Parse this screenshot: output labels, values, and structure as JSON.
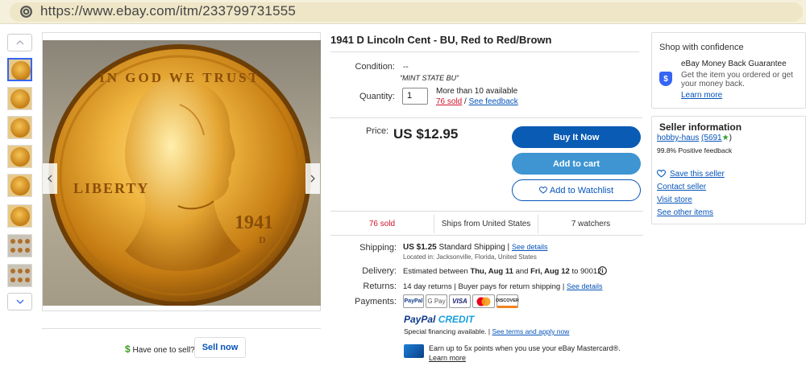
{
  "browser": {
    "url": "https://www.ebay.com/itm/233799731555"
  },
  "listing": {
    "title": "1941 D Lincoln Cent - BU, Red to Red/Brown",
    "condition_label": "Condition:",
    "condition_value": "--",
    "condition_note": "“MINT STATE BU”",
    "quantity_label": "Quantity:",
    "quantity_value": "1",
    "availability": "More than 10 available",
    "sold_link": "76 sold",
    "separator": "/",
    "feedback_link": "See feedback",
    "price_label": "Price:",
    "price": "US $12.95",
    "buy_now": "Buy It Now",
    "add_to_cart": "Add to cart",
    "add_to_watchlist": "Add to Watchlist",
    "stats": {
      "sold": "76 sold",
      "ships_from": "Ships from United States",
      "watchers": "7 watchers"
    },
    "shipping_label": "Shipping:",
    "shipping_cost": "US $1.25",
    "shipping_method": "Standard Shipping |",
    "shipping_details": "See details",
    "shipping_location": "Located in: Jacksonville, Florida, United States",
    "delivery_label": "Delivery:",
    "delivery_prefix": "Estimated between",
    "delivery_dates": "Thu, Aug 11",
    "delivery_and": "and",
    "delivery_dates2": "Fri, Aug 12",
    "delivery_suffix": "to 90012",
    "returns_label": "Returns:",
    "returns_text": "14 day returns | Buyer pays for return shipping |",
    "returns_details": "See details",
    "payments_label": "Payments:",
    "payment_methods": [
      "PayPal",
      "G Pay",
      "VISA",
      "",
      "DISCOVER"
    ],
    "paypal_credit_a": "PayPal",
    "paypal_credit_b": "CREDIT",
    "special_financing": "Special financing available. |",
    "see_terms": "See terms and apply now",
    "mastercard_text": "Earn up to 5x points when you use your eBay Mastercard®.",
    "learn_more": "Learn more"
  },
  "sell": {
    "question": "Have one to sell?",
    "button": "Sell now"
  },
  "confidence": {
    "heading": "Shop with confidence",
    "guarantee_title": "eBay Money Back Guarantee",
    "guarantee_text_1": "Get the item you ordered or get",
    "guarantee_text_2": "your money back.",
    "learn_more": "Learn more"
  },
  "seller": {
    "heading": "Seller information",
    "name": "hobby-haus",
    "score": "(5691",
    "score_end": ")",
    "positive": "99.8% Positive feedback",
    "save": "Save this seller",
    "contact": "Contact seller",
    "store": "Visit store",
    "other_items": "See other items"
  },
  "coin_text": {
    "motto": "IN GOD WE TRUST",
    "liberty": "LIBERTY",
    "year": "1941",
    "mint": "D"
  },
  "colors": {
    "buy": "#0a5bb4",
    "cart": "#3e95d2",
    "link": "#0654ba",
    "sold": "#d0142c"
  }
}
